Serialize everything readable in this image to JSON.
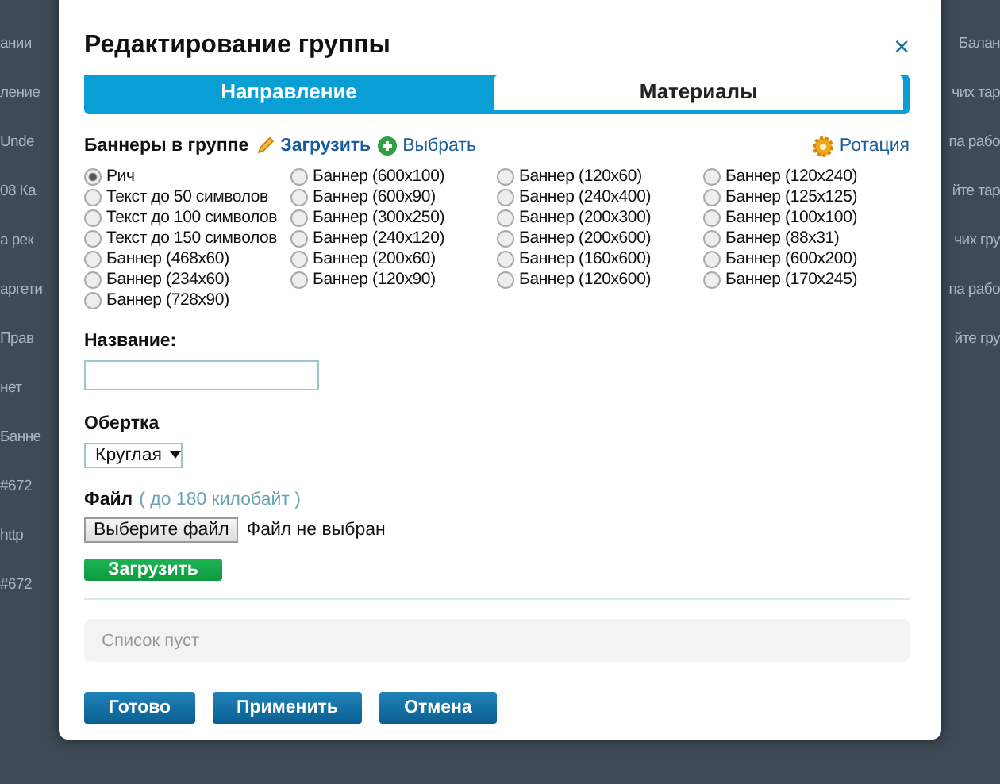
{
  "background": {
    "left": [
      "ании",
      "ление",
      "Unde",
      "08 Ка",
      "а рек",
      "аргети",
      "Прав",
      "нет",
      "Банне",
      "#672",
      "http",
      "#672"
    ],
    "right": [
      "Балан",
      "чих тар",
      "па рабо",
      "йте тар",
      "чих гру",
      "па рабо",
      "йте гру"
    ]
  },
  "dialog": {
    "title": "Редактирование группы",
    "close": "×",
    "tabs": [
      {
        "label": "Направление",
        "selected": false
      },
      {
        "label": "Материалы",
        "selected": true
      }
    ],
    "banners": {
      "label": "Баннеры в группе",
      "upload_link": "Загрузить",
      "choose_link": "Выбрать",
      "rotation_link": "Ротация",
      "columns": [
        [
          {
            "label": "Рич",
            "selected": true
          },
          {
            "label": "Текст до 50 символов",
            "selected": false
          },
          {
            "label": "Текст до 100 символов",
            "selected": false
          },
          {
            "label": "Текст до 150 символов",
            "selected": false
          },
          {
            "label": "Баннер (468x60)",
            "selected": false
          },
          {
            "label": "Баннер (234x60)",
            "selected": false
          },
          {
            "label": "Баннер (728x90)",
            "selected": false
          }
        ],
        [
          {
            "label": "Баннер (600x100)",
            "selected": false
          },
          {
            "label": "Баннер (600x90)",
            "selected": false
          },
          {
            "label": "Баннер (300x250)",
            "selected": false
          },
          {
            "label": "Баннер (240x120)",
            "selected": false
          },
          {
            "label": "Баннер (200x60)",
            "selected": false
          },
          {
            "label": "Баннер (120x90)",
            "selected": false
          }
        ],
        [
          {
            "label": "Баннер (120x60)",
            "selected": false
          },
          {
            "label": "Баннер (240x400)",
            "selected": false
          },
          {
            "label": "Баннер (200x300)",
            "selected": false
          },
          {
            "label": "Баннер (200x600)",
            "selected": false
          },
          {
            "label": "Баннер (160x600)",
            "selected": false
          },
          {
            "label": "Баннер (120x600)",
            "selected": false
          }
        ],
        [
          {
            "label": "Баннер (120x240)",
            "selected": false
          },
          {
            "label": "Баннер (125x125)",
            "selected": false
          },
          {
            "label": "Баннер (100x100)",
            "selected": false
          },
          {
            "label": "Баннер (88x31)",
            "selected": false
          },
          {
            "label": "Баннер (600x200)",
            "selected": false
          },
          {
            "label": "Баннер (170x245)",
            "selected": false
          }
        ]
      ]
    },
    "name_label": "Название:",
    "wrapper": {
      "label": "Обертка",
      "value": "Круглая"
    },
    "file": {
      "label": "Файл",
      "hint": "( до 180 килобайт )",
      "button": "Выберите файл",
      "status": "Файл не выбран"
    },
    "upload_button": "Загрузить",
    "list_empty": "Список пуст",
    "buttons": [
      "Готово",
      "Применить",
      "Отмена"
    ]
  }
}
